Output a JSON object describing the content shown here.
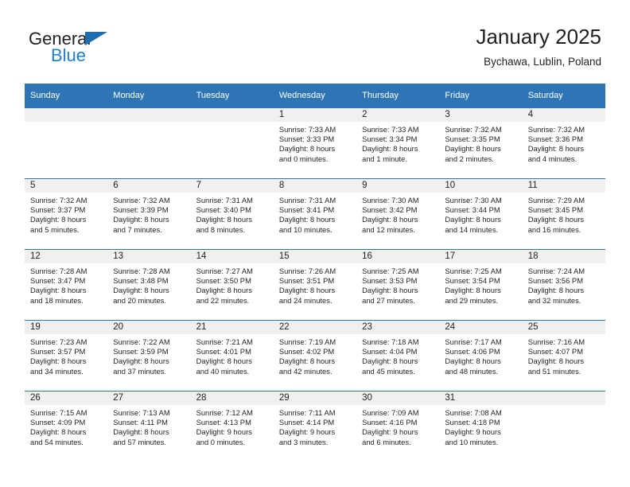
{
  "brand": {
    "name_top": "General",
    "name_bottom": "Blue",
    "triangle_color": "#1f6cb0",
    "blue_color": "#1f7fd0"
  },
  "header": {
    "title": "January 2025",
    "subtitle": "Bychawa, Lublin, Poland"
  },
  "theme": {
    "header_bg": "#2e75b6",
    "daynum_bg": "#f0f0f0",
    "text": "#231f20"
  },
  "weekday_headers": [
    "Sunday",
    "Monday",
    "Tuesday",
    "Wednesday",
    "Thursday",
    "Friday",
    "Saturday"
  ],
  "labels": {
    "sunrise": "Sunrise:",
    "sunset": "Sunset:",
    "daylight": "Daylight:"
  },
  "weeks": [
    [
      {
        "day": "",
        "empty": true
      },
      {
        "day": "",
        "empty": true
      },
      {
        "day": "",
        "empty": true
      },
      {
        "day": "1",
        "sunrise": "Sunrise: 7:33 AM",
        "sunset": "Sunset: 3:33 PM",
        "daylight1": "Daylight: 8 hours",
        "daylight2": "and 0 minutes."
      },
      {
        "day": "2",
        "sunrise": "Sunrise: 7:33 AM",
        "sunset": "Sunset: 3:34 PM",
        "daylight1": "Daylight: 8 hours",
        "daylight2": "and 1 minute."
      },
      {
        "day": "3",
        "sunrise": "Sunrise: 7:32 AM",
        "sunset": "Sunset: 3:35 PM",
        "daylight1": "Daylight: 8 hours",
        "daylight2": "and 2 minutes."
      },
      {
        "day": "4",
        "sunrise": "Sunrise: 7:32 AM",
        "sunset": "Sunset: 3:36 PM",
        "daylight1": "Daylight: 8 hours",
        "daylight2": "and 4 minutes."
      }
    ],
    [
      {
        "day": "5",
        "sunrise": "Sunrise: 7:32 AM",
        "sunset": "Sunset: 3:37 PM",
        "daylight1": "Daylight: 8 hours",
        "daylight2": "and 5 minutes."
      },
      {
        "day": "6",
        "sunrise": "Sunrise: 7:32 AM",
        "sunset": "Sunset: 3:39 PM",
        "daylight1": "Daylight: 8 hours",
        "daylight2": "and 7 minutes."
      },
      {
        "day": "7",
        "sunrise": "Sunrise: 7:31 AM",
        "sunset": "Sunset: 3:40 PM",
        "daylight1": "Daylight: 8 hours",
        "daylight2": "and 8 minutes."
      },
      {
        "day": "8",
        "sunrise": "Sunrise: 7:31 AM",
        "sunset": "Sunset: 3:41 PM",
        "daylight1": "Daylight: 8 hours",
        "daylight2": "and 10 minutes."
      },
      {
        "day": "9",
        "sunrise": "Sunrise: 7:30 AM",
        "sunset": "Sunset: 3:42 PM",
        "daylight1": "Daylight: 8 hours",
        "daylight2": "and 12 minutes."
      },
      {
        "day": "10",
        "sunrise": "Sunrise: 7:30 AM",
        "sunset": "Sunset: 3:44 PM",
        "daylight1": "Daylight: 8 hours",
        "daylight2": "and 14 minutes."
      },
      {
        "day": "11",
        "sunrise": "Sunrise: 7:29 AM",
        "sunset": "Sunset: 3:45 PM",
        "daylight1": "Daylight: 8 hours",
        "daylight2": "and 16 minutes."
      }
    ],
    [
      {
        "day": "12",
        "sunrise": "Sunrise: 7:28 AM",
        "sunset": "Sunset: 3:47 PM",
        "daylight1": "Daylight: 8 hours",
        "daylight2": "and 18 minutes."
      },
      {
        "day": "13",
        "sunrise": "Sunrise: 7:28 AM",
        "sunset": "Sunset: 3:48 PM",
        "daylight1": "Daylight: 8 hours",
        "daylight2": "and 20 minutes."
      },
      {
        "day": "14",
        "sunrise": "Sunrise: 7:27 AM",
        "sunset": "Sunset: 3:50 PM",
        "daylight1": "Daylight: 8 hours",
        "daylight2": "and 22 minutes."
      },
      {
        "day": "15",
        "sunrise": "Sunrise: 7:26 AM",
        "sunset": "Sunset: 3:51 PM",
        "daylight1": "Daylight: 8 hours",
        "daylight2": "and 24 minutes."
      },
      {
        "day": "16",
        "sunrise": "Sunrise: 7:25 AM",
        "sunset": "Sunset: 3:53 PM",
        "daylight1": "Daylight: 8 hours",
        "daylight2": "and 27 minutes."
      },
      {
        "day": "17",
        "sunrise": "Sunrise: 7:25 AM",
        "sunset": "Sunset: 3:54 PM",
        "daylight1": "Daylight: 8 hours",
        "daylight2": "and 29 minutes."
      },
      {
        "day": "18",
        "sunrise": "Sunrise: 7:24 AM",
        "sunset": "Sunset: 3:56 PM",
        "daylight1": "Daylight: 8 hours",
        "daylight2": "and 32 minutes."
      }
    ],
    [
      {
        "day": "19",
        "sunrise": "Sunrise: 7:23 AM",
        "sunset": "Sunset: 3:57 PM",
        "daylight1": "Daylight: 8 hours",
        "daylight2": "and 34 minutes."
      },
      {
        "day": "20",
        "sunrise": "Sunrise: 7:22 AM",
        "sunset": "Sunset: 3:59 PM",
        "daylight1": "Daylight: 8 hours",
        "daylight2": "and 37 minutes."
      },
      {
        "day": "21",
        "sunrise": "Sunrise: 7:21 AM",
        "sunset": "Sunset: 4:01 PM",
        "daylight1": "Daylight: 8 hours",
        "daylight2": "and 40 minutes."
      },
      {
        "day": "22",
        "sunrise": "Sunrise: 7:19 AM",
        "sunset": "Sunset: 4:02 PM",
        "daylight1": "Daylight: 8 hours",
        "daylight2": "and 42 minutes."
      },
      {
        "day": "23",
        "sunrise": "Sunrise: 7:18 AM",
        "sunset": "Sunset: 4:04 PM",
        "daylight1": "Daylight: 8 hours",
        "daylight2": "and 45 minutes."
      },
      {
        "day": "24",
        "sunrise": "Sunrise: 7:17 AM",
        "sunset": "Sunset: 4:06 PM",
        "daylight1": "Daylight: 8 hours",
        "daylight2": "and 48 minutes."
      },
      {
        "day": "25",
        "sunrise": "Sunrise: 7:16 AM",
        "sunset": "Sunset: 4:07 PM",
        "daylight1": "Daylight: 8 hours",
        "daylight2": "and 51 minutes."
      }
    ],
    [
      {
        "day": "26",
        "sunrise": "Sunrise: 7:15 AM",
        "sunset": "Sunset: 4:09 PM",
        "daylight1": "Daylight: 8 hours",
        "daylight2": "and 54 minutes."
      },
      {
        "day": "27",
        "sunrise": "Sunrise: 7:13 AM",
        "sunset": "Sunset: 4:11 PM",
        "daylight1": "Daylight: 8 hours",
        "daylight2": "and 57 minutes."
      },
      {
        "day": "28",
        "sunrise": "Sunrise: 7:12 AM",
        "sunset": "Sunset: 4:13 PM",
        "daylight1": "Daylight: 9 hours",
        "daylight2": "and 0 minutes."
      },
      {
        "day": "29",
        "sunrise": "Sunrise: 7:11 AM",
        "sunset": "Sunset: 4:14 PM",
        "daylight1": "Daylight: 9 hours",
        "daylight2": "and 3 minutes."
      },
      {
        "day": "30",
        "sunrise": "Sunrise: 7:09 AM",
        "sunset": "Sunset: 4:16 PM",
        "daylight1": "Daylight: 9 hours",
        "daylight2": "and 6 minutes."
      },
      {
        "day": "31",
        "sunrise": "Sunrise: 7:08 AM",
        "sunset": "Sunset: 4:18 PM",
        "daylight1": "Daylight: 9 hours",
        "daylight2": "and 10 minutes."
      },
      {
        "day": "",
        "empty": true
      }
    ]
  ]
}
